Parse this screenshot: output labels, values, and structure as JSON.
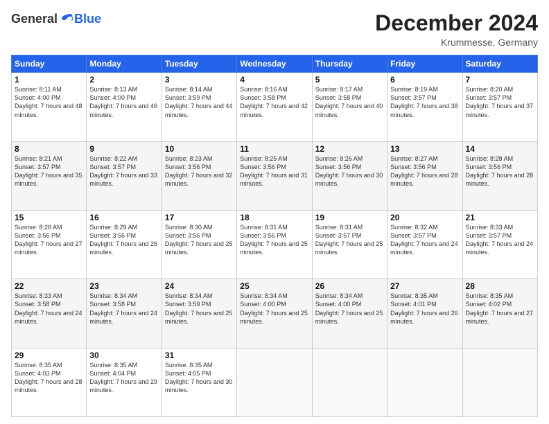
{
  "header": {
    "logo_general": "General",
    "logo_blue": "Blue",
    "month_title": "December 2024",
    "location": "Krummesse, Germany"
  },
  "days_of_week": [
    "Sunday",
    "Monday",
    "Tuesday",
    "Wednesday",
    "Thursday",
    "Friday",
    "Saturday"
  ],
  "weeks": [
    [
      {
        "day": "1",
        "sunrise": "8:11 AM",
        "sunset": "4:00 PM",
        "daylight": "7 hours and 48 minutes."
      },
      {
        "day": "2",
        "sunrise": "8:13 AM",
        "sunset": "4:00 PM",
        "daylight": "7 hours and 46 minutes."
      },
      {
        "day": "3",
        "sunrise": "8:14 AM",
        "sunset": "3:59 PM",
        "daylight": "7 hours and 44 minutes."
      },
      {
        "day": "4",
        "sunrise": "8:16 AM",
        "sunset": "3:58 PM",
        "daylight": "7 hours and 42 minutes."
      },
      {
        "day": "5",
        "sunrise": "8:17 AM",
        "sunset": "3:58 PM",
        "daylight": "7 hours and 40 minutes."
      },
      {
        "day": "6",
        "sunrise": "8:19 AM",
        "sunset": "3:57 PM",
        "daylight": "7 hours and 38 minutes."
      },
      {
        "day": "7",
        "sunrise": "8:20 AM",
        "sunset": "3:57 PM",
        "daylight": "7 hours and 37 minutes."
      }
    ],
    [
      {
        "day": "8",
        "sunrise": "8:21 AM",
        "sunset": "3:57 PM",
        "daylight": "7 hours and 35 minutes."
      },
      {
        "day": "9",
        "sunrise": "8:22 AM",
        "sunset": "3:57 PM",
        "daylight": "7 hours and 33 minutes."
      },
      {
        "day": "10",
        "sunrise": "8:23 AM",
        "sunset": "3:56 PM",
        "daylight": "7 hours and 32 minutes."
      },
      {
        "day": "11",
        "sunrise": "8:25 AM",
        "sunset": "3:56 PM",
        "daylight": "7 hours and 31 minutes."
      },
      {
        "day": "12",
        "sunrise": "8:26 AM",
        "sunset": "3:56 PM",
        "daylight": "7 hours and 30 minutes."
      },
      {
        "day": "13",
        "sunrise": "8:27 AM",
        "sunset": "3:56 PM",
        "daylight": "7 hours and 28 minutes."
      },
      {
        "day": "14",
        "sunrise": "8:28 AM",
        "sunset": "3:56 PM",
        "daylight": "7 hours and 28 minutes."
      }
    ],
    [
      {
        "day": "15",
        "sunrise": "8:28 AM",
        "sunset": "3:56 PM",
        "daylight": "7 hours and 27 minutes."
      },
      {
        "day": "16",
        "sunrise": "8:29 AM",
        "sunset": "3:56 PM",
        "daylight": "7 hours and 26 minutes."
      },
      {
        "day": "17",
        "sunrise": "8:30 AM",
        "sunset": "3:56 PM",
        "daylight": "7 hours and 25 minutes."
      },
      {
        "day": "18",
        "sunrise": "8:31 AM",
        "sunset": "3:56 PM",
        "daylight": "7 hours and 25 minutes."
      },
      {
        "day": "19",
        "sunrise": "8:31 AM",
        "sunset": "3:57 PM",
        "daylight": "7 hours and 25 minutes."
      },
      {
        "day": "20",
        "sunrise": "8:32 AM",
        "sunset": "3:57 PM",
        "daylight": "7 hours and 24 minutes."
      },
      {
        "day": "21",
        "sunrise": "8:33 AM",
        "sunset": "3:57 PM",
        "daylight": "7 hours and 24 minutes."
      }
    ],
    [
      {
        "day": "22",
        "sunrise": "8:33 AM",
        "sunset": "3:58 PM",
        "daylight": "7 hours and 24 minutes."
      },
      {
        "day": "23",
        "sunrise": "8:34 AM",
        "sunset": "3:58 PM",
        "daylight": "7 hours and 24 minutes."
      },
      {
        "day": "24",
        "sunrise": "8:34 AM",
        "sunset": "3:59 PM",
        "daylight": "7 hours and 25 minutes."
      },
      {
        "day": "25",
        "sunrise": "8:34 AM",
        "sunset": "4:00 PM",
        "daylight": "7 hours and 25 minutes."
      },
      {
        "day": "26",
        "sunrise": "8:34 AM",
        "sunset": "4:00 PM",
        "daylight": "7 hours and 25 minutes."
      },
      {
        "day": "27",
        "sunrise": "8:35 AM",
        "sunset": "4:01 PM",
        "daylight": "7 hours and 26 minutes."
      },
      {
        "day": "28",
        "sunrise": "8:35 AM",
        "sunset": "4:02 PM",
        "daylight": "7 hours and 27 minutes."
      }
    ],
    [
      {
        "day": "29",
        "sunrise": "8:35 AM",
        "sunset": "4:03 PM",
        "daylight": "7 hours and 28 minutes."
      },
      {
        "day": "30",
        "sunrise": "8:35 AM",
        "sunset": "4:04 PM",
        "daylight": "7 hours and 29 minutes."
      },
      {
        "day": "31",
        "sunrise": "8:35 AM",
        "sunset": "4:05 PM",
        "daylight": "7 hours and 30 minutes."
      },
      null,
      null,
      null,
      null
    ]
  ]
}
